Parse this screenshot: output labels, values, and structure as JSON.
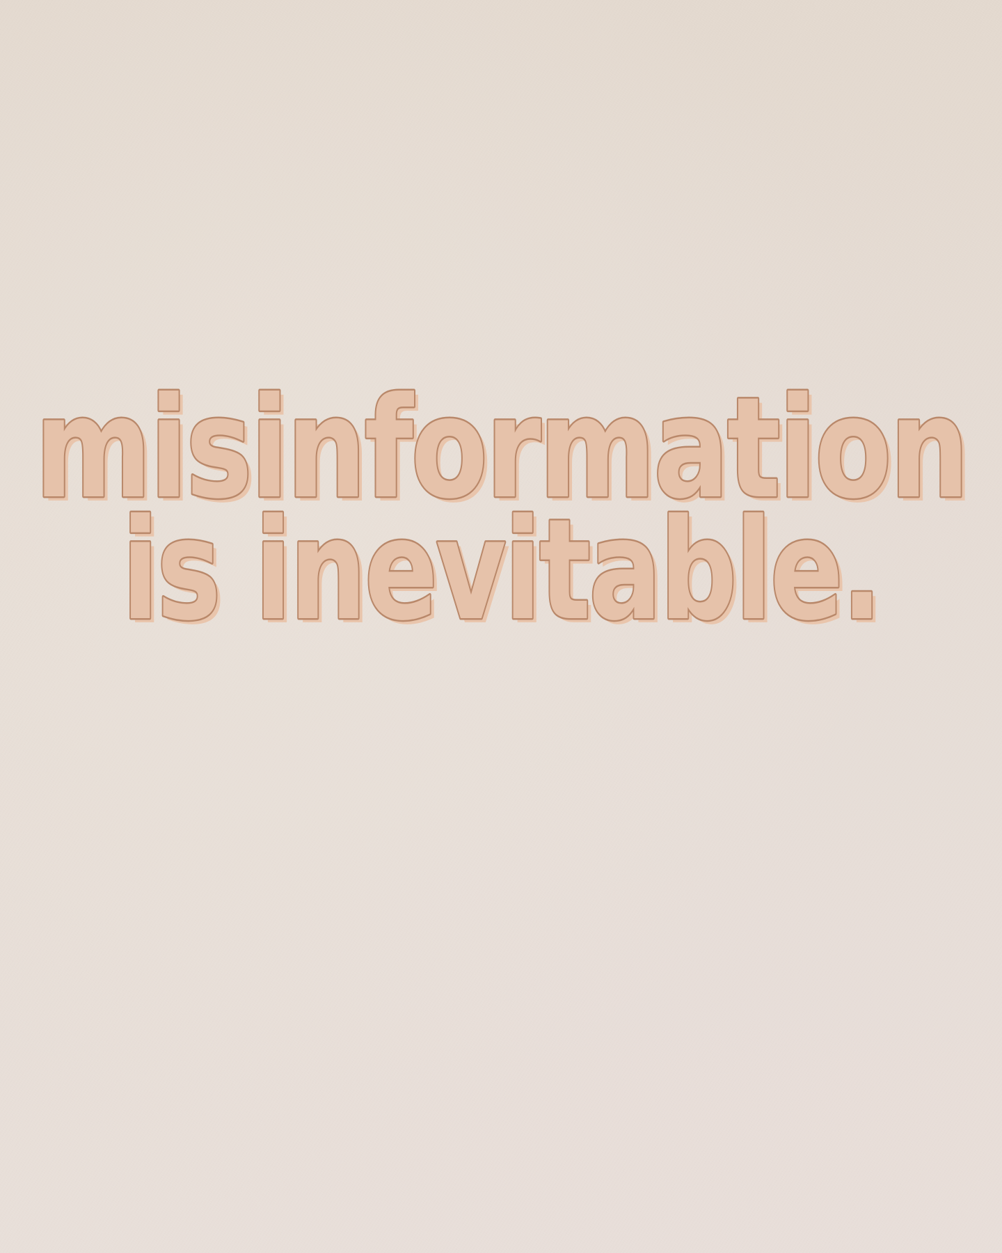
{
  "headline": {
    "line1": "misinformation",
    "line2": "is inevitable."
  },
  "colors": {
    "background": "#e6dcd4",
    "text_fill": "#e6c2aa",
    "text_outline": "#b9886a",
    "text_shadow": "#eac3a8"
  }
}
